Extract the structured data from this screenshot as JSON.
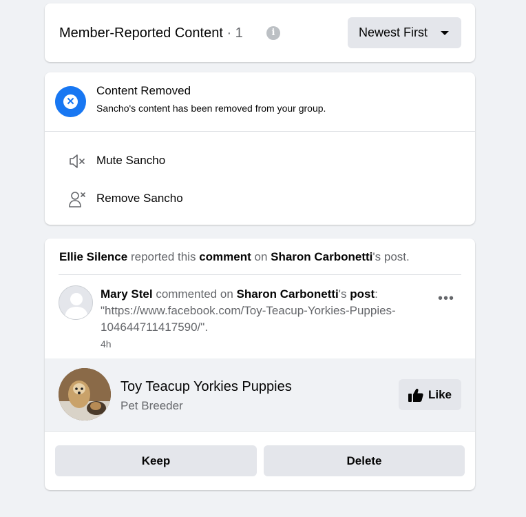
{
  "header": {
    "title": "Member-Reported Content",
    "separator": " · ",
    "count": "1",
    "info_icon": "info-icon",
    "sort_label": "Newest First",
    "sort_icon": "caret-down-icon"
  },
  "removed": {
    "icon": "close-icon",
    "title": "Content Removed",
    "subtitle": "Sancho's content has been removed from your group.",
    "actions": [
      {
        "icon": "mute-icon",
        "label": "Mute Sancho"
      },
      {
        "icon": "remove-person-icon",
        "label": "Remove Sancho"
      }
    ]
  },
  "report": {
    "reporter": "Ellie Silence",
    "reported_text": " reported this ",
    "object": "comment",
    "on_text": " on ",
    "post_owner": "Sharon Carbonetti",
    "post_suffix": "'s post.",
    "comment": {
      "author": "Mary Stel",
      "commented_text": " commented on ",
      "post_owner": "Sharon Carbonetti",
      "possessive": "'s ",
      "post_word": "post",
      "colon": ":",
      "body": " \"https://www.facebook.com/Toy-Teacup-Yorkies-Puppies-104644711417590/\".",
      "time": "4h",
      "more_icon": "more-icon"
    },
    "page": {
      "name": "Toy Teacup Yorkies Puppies",
      "category": "Pet Breeder",
      "like_label": "Like",
      "like_icon": "thumbs-up-icon"
    },
    "keep_label": "Keep",
    "delete_label": "Delete"
  }
}
